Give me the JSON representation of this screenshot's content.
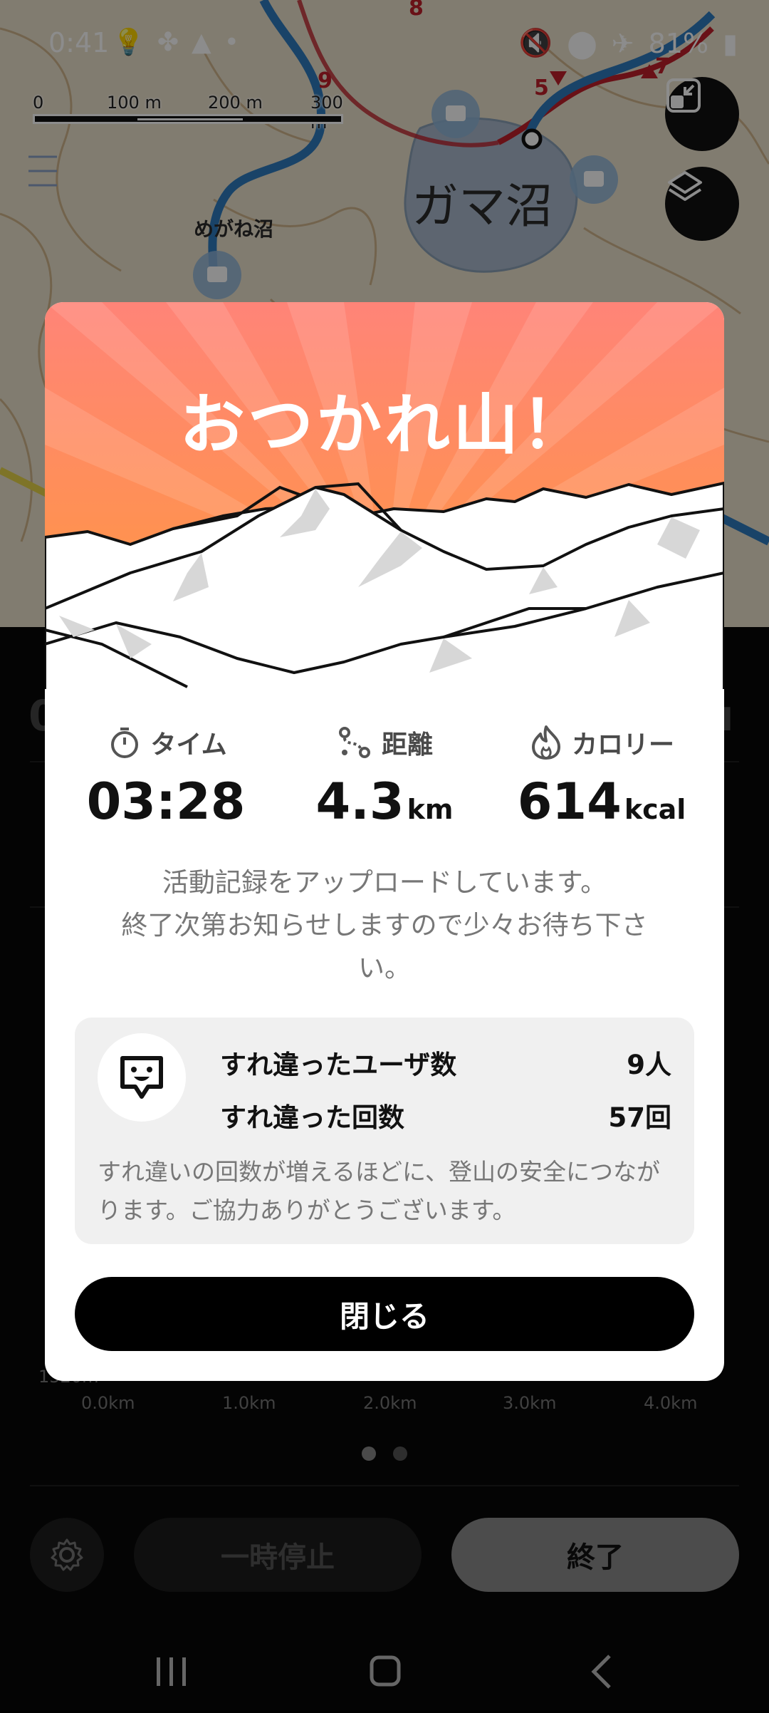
{
  "status_bar": {
    "time": "0:41",
    "battery": "81%",
    "left_icons": [
      "bulb-icon",
      "fan-icon",
      "triangle-icon",
      "dot-icon"
    ],
    "right_icons": [
      "mute-icon",
      "location-icon",
      "airplane-icon",
      "battery-icon"
    ]
  },
  "map": {
    "scale_labels": [
      "0",
      "100 m",
      "200 m",
      "300 m"
    ],
    "place_large": "ガマ沼",
    "place_small": "めがね沼",
    "route_markers": [
      "8",
      "9",
      "5",
      "7"
    ],
    "buttons": [
      "fit-view-icon",
      "layers-icon"
    ]
  },
  "background_panel": {
    "ghost_left": "0",
    "ghost_right": "ı",
    "elevation_label": "1520m",
    "distance_ticks": [
      "0.0km",
      "1.0km",
      "2.0km",
      "3.0km",
      "4.0km"
    ],
    "page_dots": 2,
    "active_dot": 0,
    "pause_label": "一時停止",
    "end_label": "終了"
  },
  "modal": {
    "title": "おつかれ山！",
    "stats": {
      "time": {
        "label": "タイム",
        "value": "03:28",
        "unit": ""
      },
      "distance": {
        "label": "距離",
        "value": "4.3",
        "unit": "km"
      },
      "calories": {
        "label": "カロリー",
        "value": "614",
        "unit": "kcal"
      }
    },
    "message_line1": "活動記録をアップロードしています。",
    "message_line2": "終了次第お知らせしますので少々お待ち下さ",
    "message_line3": "い。",
    "passing": {
      "users_label": "すれ違ったユーザ数",
      "users_value": "9人",
      "count_label": "すれ違った回数",
      "count_value": "57回",
      "note": "すれ違いの回数が増えるほどに、登山の安全につながります。ご協力ありがとうございます。"
    },
    "close_label": "閉じる"
  },
  "colors": {
    "hero_top": "#ff8478",
    "hero_bottom": "#ff9a38",
    "route_blue": "#2f7bbd",
    "route_red": "#c0202a"
  }
}
